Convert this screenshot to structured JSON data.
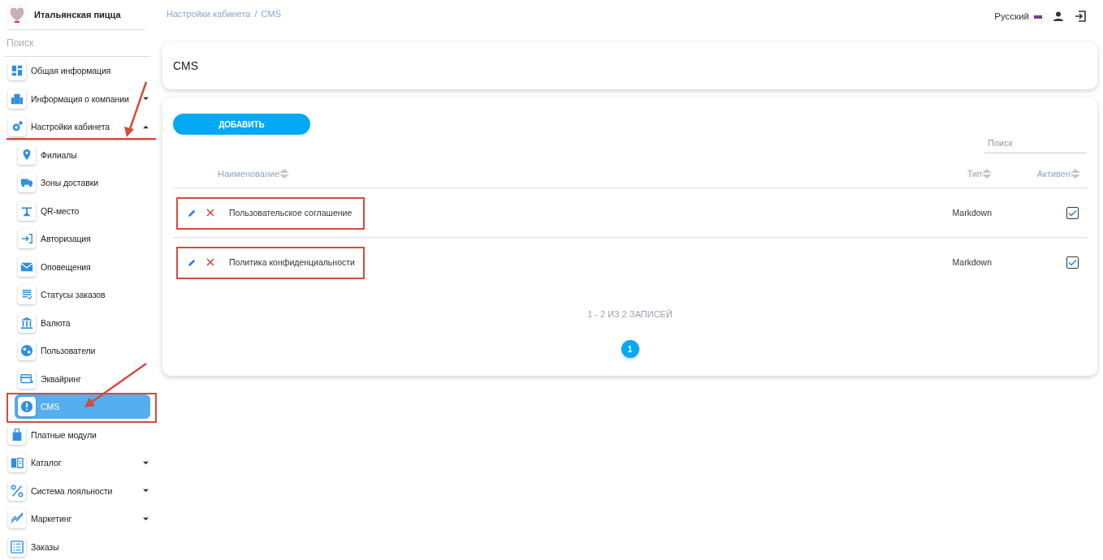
{
  "sidebar": {
    "brand": "Итальянская пицца",
    "search": {
      "placeholder": "Поиск"
    },
    "items": [
      {
        "label": "Общая информация",
        "selected": false
      },
      {
        "label": "Информация о компании",
        "expanded": false,
        "selected": false
      },
      {
        "label": "Настройки кабинета",
        "expanded": true,
        "selected": false,
        "underlined": true,
        "arrowed": true,
        "children": [
          {
            "label": "Филиалы",
            "selected": false
          },
          {
            "label": "Зоны доставки",
            "selected": false
          },
          {
            "label": "QR-место",
            "selected": false
          },
          {
            "label": "Авторизация",
            "selected": false
          },
          {
            "label": "Оповещения",
            "selected": false
          },
          {
            "label": "Статусы заказов",
            "selected": false
          },
          {
            "label": "Валюта",
            "selected": false
          },
          {
            "label": "Пользователи",
            "selected": false
          },
          {
            "label": "Эквайринг",
            "selected": false
          },
          {
            "label": "CMS",
            "selected": true,
            "framed": true,
            "arrowed": true
          }
        ]
      },
      {
        "label": "Платные модули",
        "selected": false
      },
      {
        "label": "Каталог",
        "expanded": false,
        "selected": false
      },
      {
        "label": "Система лояльности",
        "expanded": false,
        "selected": false
      },
      {
        "label": "Маркетинг",
        "expanded": false,
        "selected": false
      },
      {
        "label": "Заказы",
        "selected": false
      }
    ]
  },
  "breadcrumb": {
    "items": [
      "Настройки кабинета",
      "CMS"
    ],
    "separator": "/"
  },
  "topbar": {
    "language": "Русский"
  },
  "page_title": "CMS",
  "add_button": "ДОБАВИТЬ",
  "table_search": {
    "placeholder": "Поиск"
  },
  "table": {
    "columns": [
      "Наименование",
      "Тип",
      "Активен"
    ],
    "rows": [
      {
        "name": "Пользовательское соглашение",
        "type": "Markdown",
        "active": true,
        "framed": true
      },
      {
        "name": "Политика конфиденциальности",
        "type": "Markdown",
        "active": true,
        "framed": true
      }
    ]
  },
  "pagination": {
    "summary": "1 - 2 ИЗ 2 ЗАПИСЕЙ",
    "pages": [
      {
        "label": "1",
        "selected": true
      }
    ]
  }
}
